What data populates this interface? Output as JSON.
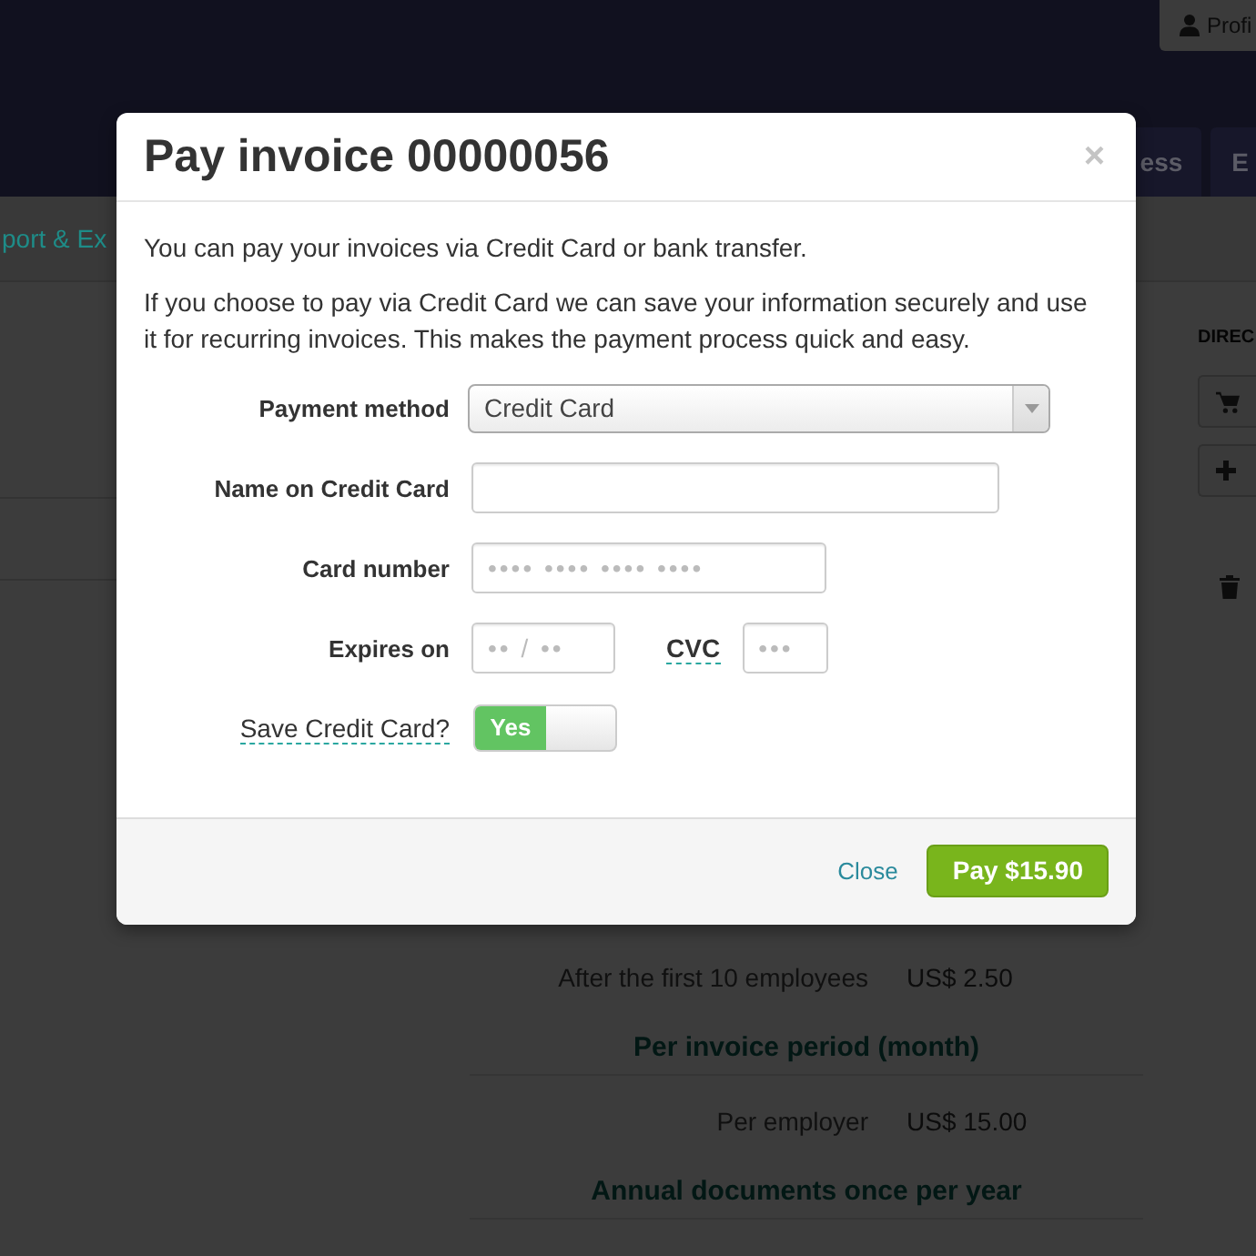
{
  "page": {
    "profile_button": {
      "label": "Profi"
    },
    "nav_tabs": [
      {
        "label": "ess",
        "selected": false
      },
      {
        "label": "E",
        "selected": false
      }
    ],
    "subnav": {
      "link": "port & Ex"
    },
    "sidebar": {
      "heading": "DIREC"
    },
    "pricing": [
      {
        "kind": "row",
        "label": "After the first 10 employees",
        "value": "US$ 2.50"
      },
      {
        "kind": "heading",
        "text": "Per invoice period (month)"
      },
      {
        "kind": "row",
        "label": "Per employer",
        "value": "US$ 15.00"
      },
      {
        "kind": "heading",
        "text": "Annual documents once per year"
      }
    ]
  },
  "modal": {
    "title": "Pay invoice 00000056",
    "close_symbol": "×",
    "paragraphs": [
      "You can pay your invoices via Credit Card or bank transfer.",
      "If you choose to pay via Credit Card we can save your information securely and use it for recurring invoices. This makes the payment process quick and easy."
    ],
    "form": [
      {
        "kind": "select",
        "label": "Payment method",
        "label_tooltip": false,
        "value": "Credit Card"
      },
      {
        "kind": "textbox",
        "label": "Name on Credit Card",
        "label_tooltip": false
      },
      {
        "kind": "cardbox",
        "label": "Card number",
        "label_tooltip": false,
        "placeholder": "•••• •••• •••• ••••"
      },
      {
        "kind": "expiry",
        "label": "Expires on",
        "label_tooltip": false,
        "placeholder": "•• / ••",
        "cvc_label": "CVC",
        "cvc_tooltip": true,
        "cvc_placeholder": "•••"
      },
      {
        "kind": "switch",
        "label": "Save Credit Card?",
        "label_tooltip": true,
        "on": true,
        "on_label": "Yes"
      }
    ],
    "footer": {
      "close_link": "Close",
      "pay_button": "Pay $15.90"
    }
  }
}
